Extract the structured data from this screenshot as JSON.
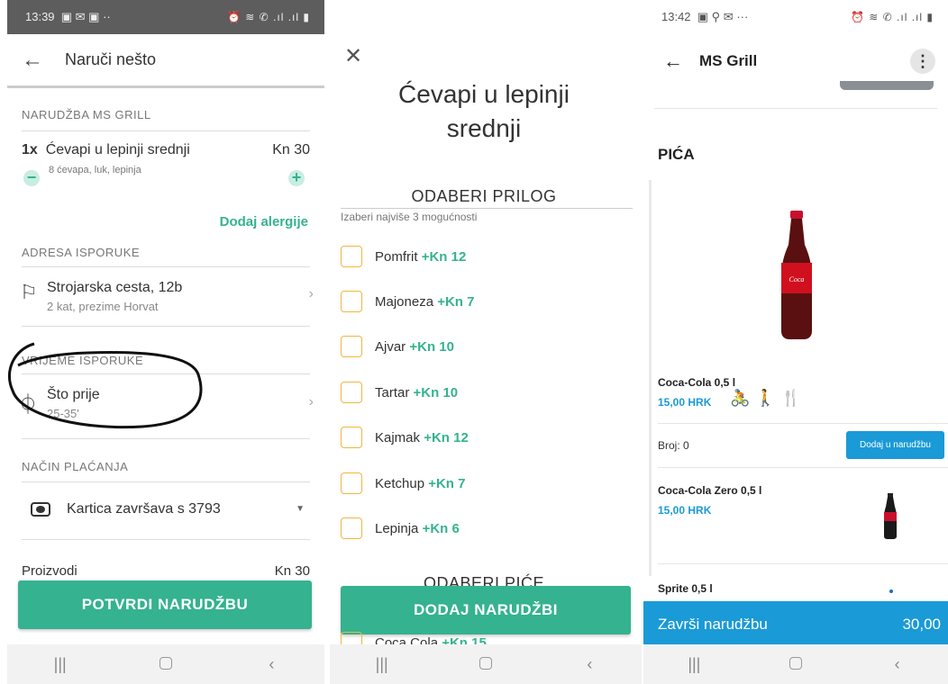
{
  "p1": {
    "status": {
      "time": "13:39",
      "left_icons": "▣ ✉ ▣ ··",
      "right_icons": "⏰ ≋ ✆ .ıl .ıl ▮"
    },
    "header": {
      "title": "Naruči nešto"
    },
    "order_section": "NARUDŽBA MS GRILL",
    "item": {
      "qty": "1x",
      "name": "Ćevapi u lepinji srednji",
      "price": "Kn 30",
      "desc": "8 ćevapa, luk, lepinja"
    },
    "allergies_link": "Dodaj alergije",
    "address_section": "ADRESA ISPORUKE",
    "address": {
      "line1": "Strojarska cesta, 12b",
      "line2": "2 kat, prezime Horvat"
    },
    "time_section": "VRIJEME ISPORUKE",
    "time": {
      "line1": "Što prije",
      "line2": "25-35'"
    },
    "payment_section": "NAČIN PLAĆANJA",
    "payment": "Kartica završava s 3793",
    "products_label": "Proizvodi",
    "products_total": "Kn 30",
    "confirm_button": "POTVRDI NARUDŽBU"
  },
  "p2": {
    "title_line1": "Ćevapi u lepinji",
    "title_line2": "srednji",
    "section_title": "ODABERI PRILOG",
    "section_hint": "Izaberi najviše 3 mogućnosti",
    "options": [
      {
        "label": "Pomfrit",
        "price": "+Kn 12"
      },
      {
        "label": "Majoneza",
        "price": "+Kn 7"
      },
      {
        "label": "Ajvar",
        "price": "+Kn 10"
      },
      {
        "label": "Tartar",
        "price": "+Kn 10"
      },
      {
        "label": "Kajmak",
        "price": "+Kn 12"
      },
      {
        "label": "Ketchup",
        "price": "+Kn 7"
      },
      {
        "label": "Lepinja",
        "price": "+Kn 6"
      }
    ],
    "drinks_title": "ODABERI PIĆE",
    "drink_option": {
      "label": "Coca Cola",
      "price": "+Kn 15"
    },
    "add_button": "DODAJ NARUDŽBI"
  },
  "p3": {
    "status": {
      "time": "13:42",
      "left_icons": "▣ ⚲ ✉ ···",
      "right_icons": "⏰ ≋ ✆ .ıl .ıl ▮"
    },
    "header": {
      "title": "MS Grill"
    },
    "section": "PIĆA",
    "items": [
      {
        "name": "Coca-Cola 0,5 l",
        "price": "15,00 HRK"
      },
      {
        "name": "Coca-Cola Zero 0,5 l",
        "price": "15,00 HRK"
      },
      {
        "name": "Sprite 0,5 l"
      }
    ],
    "count_label": "Broj: 0",
    "add_button": "Dodaj u narudžbu",
    "footer": {
      "label": "Završi narudžbu",
      "amount": "30,00"
    },
    "colors": {
      "accent": "#1a9ad6"
    }
  },
  "colors": {
    "green": "#35b28f",
    "checkbox": "#f0b541"
  }
}
